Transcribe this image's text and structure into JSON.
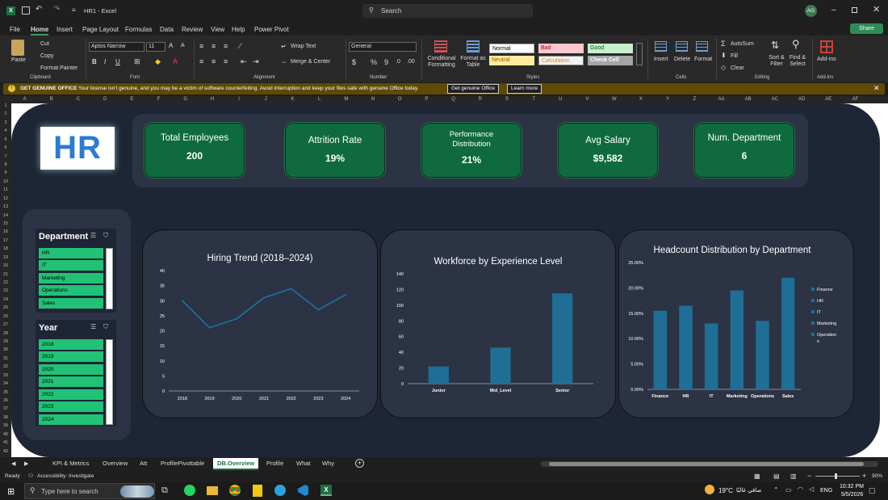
{
  "app": {
    "title": "HR1 - Excel",
    "search_placeholder": "Search",
    "user_initials": "AG",
    "share": "Share"
  },
  "menu": [
    "File",
    "Home",
    "Insert",
    "Page Layout",
    "Formulas",
    "Data",
    "Review",
    "View",
    "Help",
    "Power Pivot"
  ],
  "ribbon": {
    "paste": "Paste",
    "cut": "Cut",
    "copy": "Copy",
    "format_painter": "Format Painter",
    "clipboard": "Clipboard",
    "font_name": "Aptos Narrow",
    "font_size": "11",
    "font": "Font",
    "wrap_text": "Wrap Text",
    "merge_center": "Merge & Center",
    "alignment": "Alignment",
    "number_format": "General",
    "number": "Number",
    "conditional_formatting": "Conditional Formatting",
    "format_as_table": "Format as Table",
    "styles_cells": [
      "Normal",
      "Bad",
      "Good",
      "Neutral",
      "Calculation",
      "Check Cell"
    ],
    "styles": "Styles",
    "insert": "Insert",
    "delete": "Delete",
    "format": "Format",
    "cells": "Cells",
    "autosum": "AutoSum",
    "fill": "Fill",
    "clear": "Clear",
    "sort_filter": "Sort & Filter",
    "find_select": "Find & Select",
    "editing": "Editing",
    "addins": "Add-ins",
    "addins_group": "Add-ins"
  },
  "notice": {
    "title": "GET GENUINE OFFICE",
    "message": "Your license isn't genuine, and you may be a victim of software counterfeiting. Avoid interruption and keep your files safe with genuine Office today.",
    "btn_genuine": "Get genuine Office",
    "btn_learn": "Learn more"
  },
  "columns": [
    "A",
    "B",
    "C",
    "D",
    "E",
    "F",
    "G",
    "H",
    "I",
    "J",
    "K",
    "L",
    "M",
    "N",
    "O",
    "P",
    "Q",
    "R",
    "S",
    "T",
    "U",
    "V",
    "W",
    "X",
    "Y",
    "Z",
    "AA",
    "AB",
    "AC",
    "AD",
    "AE",
    "AF"
  ],
  "rows": [
    "1",
    "2",
    "3",
    "4",
    "5",
    "6",
    "7",
    "8",
    "9",
    "10",
    "11",
    "12",
    "13",
    "14",
    "15",
    "16",
    "17",
    "18",
    "19",
    "20",
    "21",
    "22",
    "23",
    "24",
    "25",
    "26",
    "27",
    "28",
    "29",
    "30",
    "31",
    "32",
    "33",
    "34",
    "35",
    "36",
    "37",
    "38",
    "39",
    "40",
    "41",
    "42"
  ],
  "dashboard": {
    "logo": "HR",
    "kpis": [
      {
        "title": "Total Employees",
        "value": "200"
      },
      {
        "title": "Attrition Rate",
        "value": "19%"
      },
      {
        "title": "Performance Distribution",
        "value": "21%"
      },
      {
        "title": "Avg Salary",
        "value": "$9,582"
      },
      {
        "title": "Num. Department",
        "value": "6"
      }
    ],
    "slicers": [
      {
        "title": "Department",
        "items": [
          "HR",
          "IT",
          "Marketing",
          "Operations",
          "Sales"
        ]
      },
      {
        "title": "Year",
        "items": [
          "2018",
          "2019",
          "2020",
          "2021",
          "2022",
          "2023",
          "2024"
        ]
      }
    ]
  },
  "chart_data": [
    {
      "type": "line",
      "title": "Hiring Trend (2018–2024)",
      "x": [
        "2018",
        "2019",
        "2020",
        "2021",
        "2022",
        "2023",
        "2024"
      ],
      "values": [
        30,
        21,
        24,
        31,
        34,
        27,
        32
      ],
      "yticks": [
        "0",
        "5",
        "10",
        "15",
        "20",
        "25",
        "30",
        "35",
        "40"
      ],
      "ylim": [
        0,
        40
      ],
      "color": "#1f6e96"
    },
    {
      "type": "bar",
      "title": "Workforce by Experience Level",
      "categories": [
        "Junior",
        "Mid_Level",
        "Senior"
      ],
      "values": [
        22,
        46,
        115
      ],
      "yticks": [
        "0",
        "20",
        "40",
        "60",
        "80",
        "100",
        "120",
        "140"
      ],
      "ylim": [
        0,
        140
      ],
      "color": "#1f6e96"
    },
    {
      "type": "bar",
      "title": "Headcount Distribution by Department",
      "categories": [
        "Finance",
        "HR",
        "IT",
        "Marketing",
        "Operations",
        "Sales"
      ],
      "values": [
        15.5,
        16.5,
        13,
        19.5,
        13.5,
        22
      ],
      "yticks": [
        "0.00%",
        "5.00%",
        "10.00%",
        "15.00%",
        "20.00%",
        "25.00%"
      ],
      "ylim": [
        0,
        25
      ],
      "legend": [
        "Finance",
        "HR",
        "IT",
        "Marketing",
        "Operation s"
      ],
      "color": "#1f6e96"
    }
  ],
  "sheet_tabs": [
    "KPI & Metrics",
    "Overview",
    "Att",
    "ProfilePivottable",
    "DB.Overview",
    "Profile",
    "What",
    "Why"
  ],
  "active_tab": "DB.Overview",
  "status": {
    "ready": "Ready",
    "accessibility": "Accessibility: Investigate",
    "zoom": "90%"
  },
  "taskbar": {
    "search_placeholder": "Type here to search",
    "weather": "19°C",
    "weather_text": "صافي غالبًا",
    "lang": "ENG",
    "time": "10:32 PM",
    "date": "5/5/2026"
  }
}
